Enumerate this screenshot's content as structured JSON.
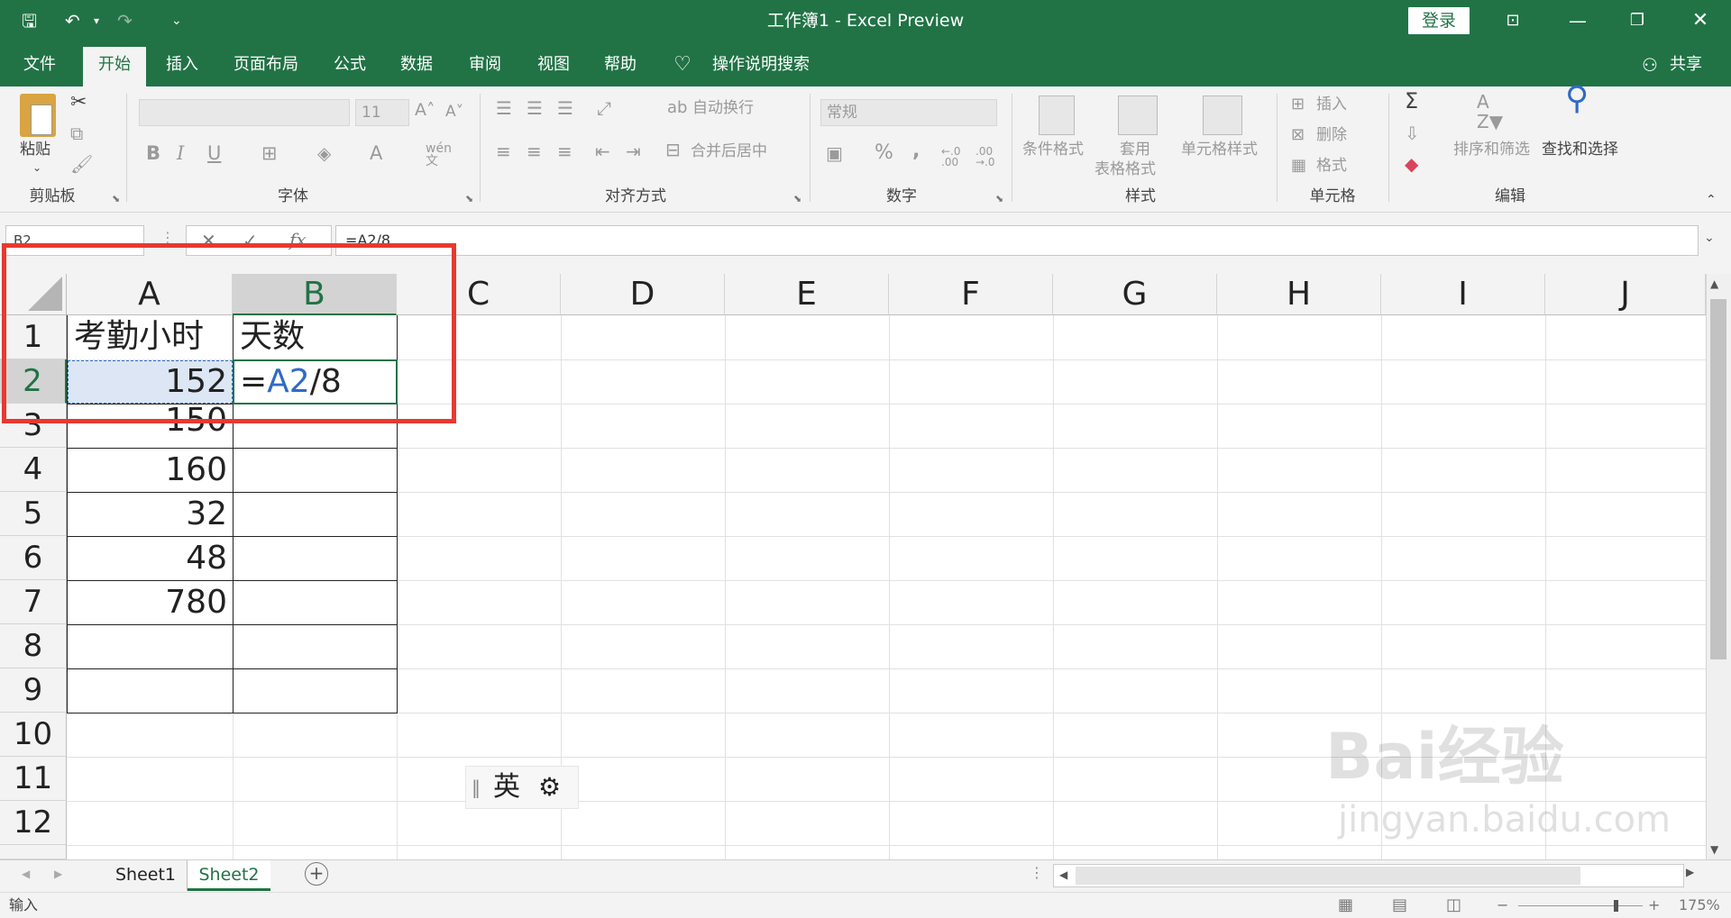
{
  "window": {
    "title": "工作簿1  -  Excel Preview",
    "login": "登录"
  },
  "quick_access": {
    "save": "🖫",
    "undo": "↶",
    "redo": "↷",
    "customize": "⌄"
  },
  "menu": {
    "tabs": [
      "文件",
      "开始",
      "插入",
      "页面布局",
      "公式",
      "数据",
      "审阅",
      "视图",
      "帮助"
    ],
    "tell_me": "操作说明搜索",
    "share": "共享"
  },
  "ribbon": {
    "clipboard": {
      "paste": "粘贴",
      "label": "剪贴板"
    },
    "font": {
      "name": "",
      "size": "11",
      "label": "字体",
      "bold": "B",
      "italic": "I",
      "underline": "U"
    },
    "alignment": {
      "wrap": "自动换行",
      "merge": "合并后居中",
      "label": "对齐方式"
    },
    "number": {
      "format": "常规",
      "percent": "%",
      "comma": ",",
      "label": "数字"
    },
    "styles": {
      "conditional": "条件格式",
      "table_1": "套用",
      "table_2": "表格格式",
      "cell_styles": "单元格样式",
      "label": "样式"
    },
    "cells": {
      "insert": "插入",
      "delete": "删除",
      "format": "格式",
      "label": "单元格"
    },
    "editing": {
      "sort": "排序和筛选",
      "find": "查找和选择",
      "label": "编辑"
    }
  },
  "formula_bar": {
    "name_box": "B2",
    "formula": "=A2/8"
  },
  "grid": {
    "columns": [
      "A",
      "B",
      "C",
      "D",
      "E",
      "F",
      "G",
      "H",
      "I",
      "J"
    ],
    "rows": [
      "1",
      "2",
      "3",
      "4",
      "5",
      "6",
      "7",
      "8",
      "9",
      "10",
      "11",
      "12"
    ],
    "cells": {
      "A1": "考勤小时",
      "B1": "天数",
      "A2": "152",
      "B2_eq": "=",
      "B2_ref": "A2",
      "B2_rest": "/8",
      "A3": "150",
      "A4": "160",
      "A5": "32",
      "A6": "48",
      "A7": "780"
    },
    "ref_color": "#2f6bc4"
  },
  "sheets": {
    "tabs": [
      "Sheet1",
      "Sheet2"
    ],
    "active": "Sheet2"
  },
  "status": {
    "mode": "输入",
    "zoom": "175%"
  },
  "ime": {
    "lang": "英"
  },
  "watermark": {
    "line1": "Bai经验",
    "line2": "jingyan.baidu.com"
  },
  "colors": {
    "brand": "#217346",
    "highlight": "#e8392f"
  }
}
